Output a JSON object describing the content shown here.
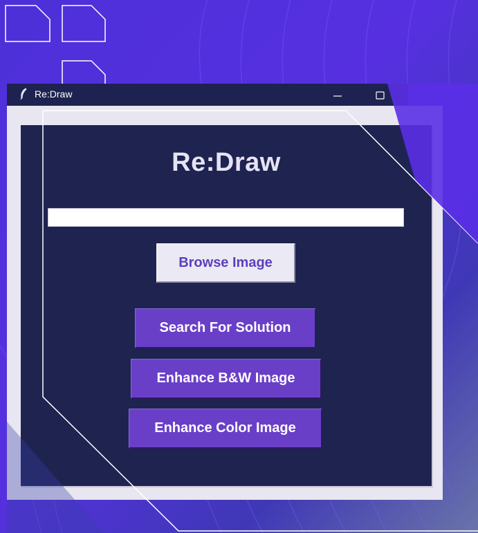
{
  "window": {
    "title": "Re:Draw",
    "minimize_symbol": "—",
    "maximize_symbol": "☐"
  },
  "app": {
    "heading": "Re:Draw",
    "path_value": "",
    "browse_label": "Browse Image",
    "search_label": "Search For Solution",
    "enhance_bw_label": "Enhance B&W Image",
    "enhance_color_label": "Enhance Color Image"
  },
  "colors": {
    "background": "#4a2fd6",
    "panel": "#1e2350",
    "frame": "#e8e6f0",
    "accent_button": "#6a3fc8",
    "browse_text": "#5b3fbf"
  },
  "icons": {
    "title_icon": "feather-icon"
  }
}
